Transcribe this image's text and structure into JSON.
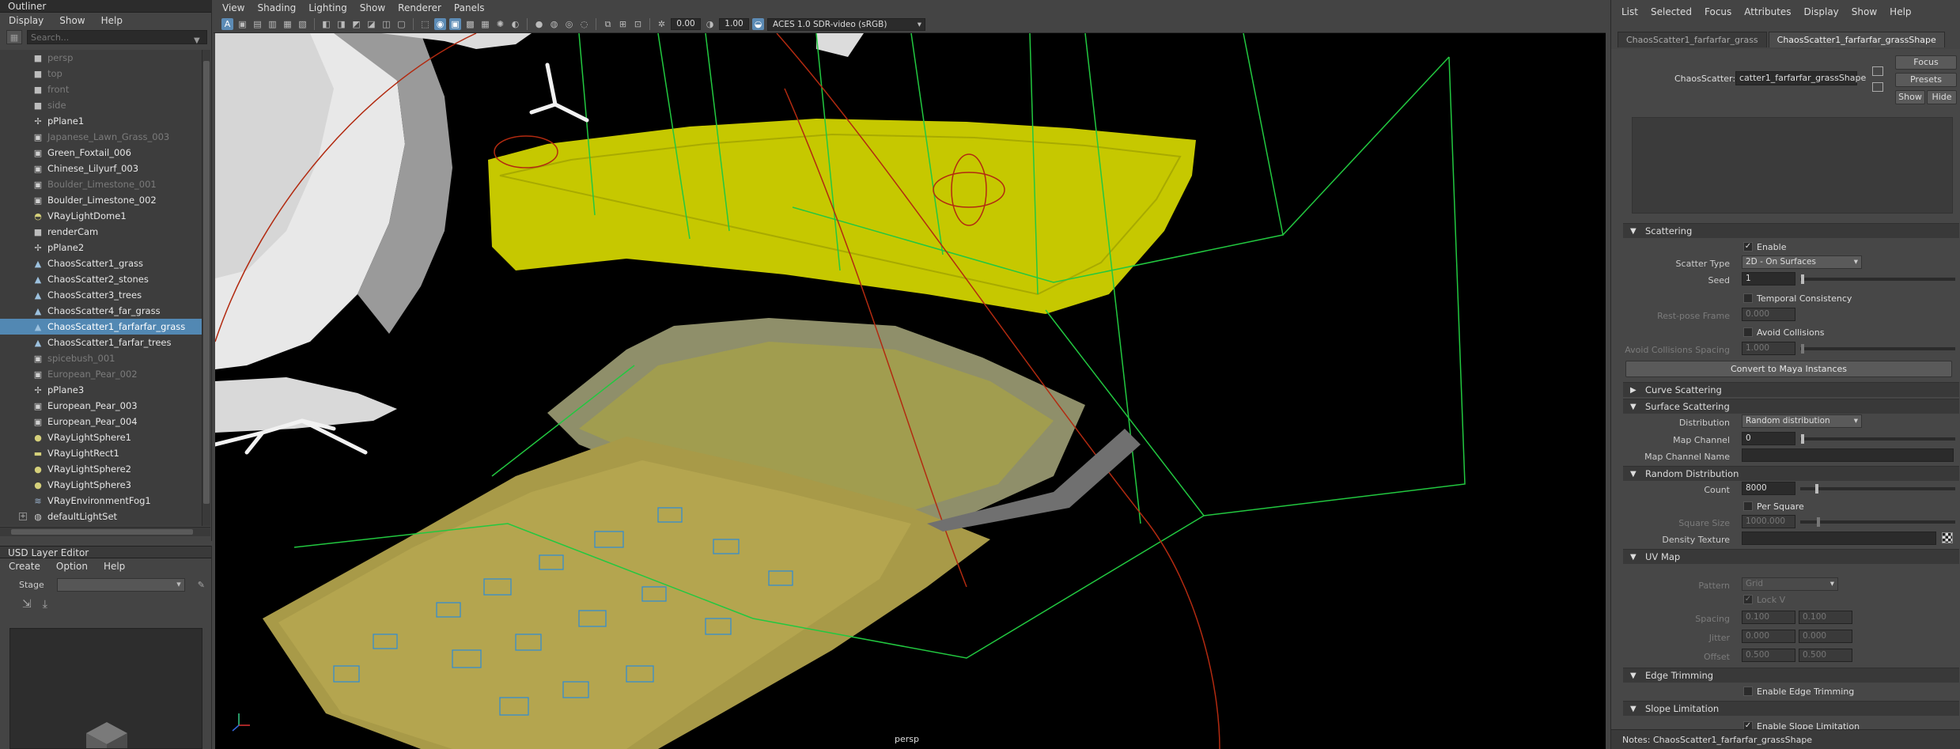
{
  "outliner": {
    "title": "Outliner",
    "menu": [
      "Display",
      "Show",
      "Help"
    ],
    "search_placeholder": "Search...",
    "items": [
      {
        "label": "persp",
        "icon": "camera-icon",
        "dim": true,
        "selected": false
      },
      {
        "label": "top",
        "icon": "camera-icon",
        "dim": true,
        "selected": false
      },
      {
        "label": "front",
        "icon": "camera-icon",
        "dim": true,
        "selected": false
      },
      {
        "label": "side",
        "icon": "camera-icon",
        "dim": true,
        "selected": false
      },
      {
        "label": "pPlane1",
        "icon": "transform-icon",
        "dim": false,
        "selected": false
      },
      {
        "label": "Japanese_Lawn_Grass_003",
        "icon": "mesh-icon",
        "dim": true,
        "selected": false
      },
      {
        "label": "Green_Foxtail_006",
        "icon": "mesh-icon",
        "dim": false,
        "selected": false
      },
      {
        "label": "Chinese_Lilyurf_003",
        "icon": "mesh-icon",
        "dim": false,
        "selected": false
      },
      {
        "label": "Boulder_Limestone_001",
        "icon": "mesh-icon",
        "dim": true,
        "selected": false
      },
      {
        "label": "Boulder_Limestone_002",
        "icon": "mesh-icon",
        "dim": false,
        "selected": false
      },
      {
        "label": "VRayLightDome1",
        "icon": "dome-light-icon",
        "dim": false,
        "selected": false
      },
      {
        "label": "renderCam",
        "icon": "camera-icon",
        "dim": false,
        "selected": false
      },
      {
        "label": "pPlane2",
        "icon": "transform-icon",
        "dim": false,
        "selected": false
      },
      {
        "label": "ChaosScatter1_grass",
        "icon": "scatter-icon",
        "dim": false,
        "selected": false
      },
      {
        "label": "ChaosScatter2_stones",
        "icon": "scatter-icon",
        "dim": false,
        "selected": false
      },
      {
        "label": "ChaosScatter3_trees",
        "icon": "scatter-icon",
        "dim": false,
        "selected": false
      },
      {
        "label": "ChaosScatter4_far_grass",
        "icon": "scatter-icon",
        "dim": false,
        "selected": false
      },
      {
        "label": "ChaosScatter1_farfarfar_grass",
        "icon": "scatter-icon",
        "dim": false,
        "selected": true
      },
      {
        "label": "ChaosScatter1_farfar_trees",
        "icon": "scatter-icon",
        "dim": false,
        "selected": false
      },
      {
        "label": "spicebush_001",
        "icon": "mesh-icon",
        "dim": true,
        "selected": false
      },
      {
        "label": "European_Pear_002",
        "icon": "mesh-icon",
        "dim": true,
        "selected": false
      },
      {
        "label": "pPlane3",
        "icon": "transform-icon",
        "dim": false,
        "selected": false
      },
      {
        "label": "European_Pear_003",
        "icon": "mesh-icon",
        "dim": false,
        "selected": false
      },
      {
        "label": "European_Pear_004",
        "icon": "mesh-icon",
        "dim": false,
        "selected": false
      },
      {
        "label": "VRayLightSphere1",
        "icon": "sphere-light-icon",
        "dim": false,
        "selected": false
      },
      {
        "label": "VRayLightRect1",
        "icon": "rect-light-icon",
        "dim": false,
        "selected": false
      },
      {
        "label": "VRayLightSphere2",
        "icon": "sphere-light-icon",
        "dim": false,
        "selected": false
      },
      {
        "label": "VRayLightSphere3",
        "icon": "sphere-light-icon",
        "dim": false,
        "selected": false
      },
      {
        "label": "VRayEnvironmentFog1",
        "icon": "fog-icon",
        "dim": false,
        "selected": false
      },
      {
        "label": "defaultLightSet",
        "icon": "set-icon",
        "dim": false,
        "selected": false,
        "expandable": true
      }
    ]
  },
  "usd": {
    "title": "USD Layer Editor",
    "menu": [
      "Create",
      "Option",
      "Help"
    ],
    "stage_label": "Stage"
  },
  "viewport": {
    "menu": [
      "View",
      "Shading",
      "Lighting",
      "Show",
      "Renderer",
      "Panels"
    ],
    "exposure": "0.00",
    "gamma": "1.00",
    "color_space": "ACES 1.0 SDR-video (sRGB)",
    "camera_label": "persp"
  },
  "attr": {
    "menu": [
      "List",
      "Selected",
      "Focus",
      "Attributes",
      "Display",
      "Show",
      "Help"
    ],
    "tabs": [
      "ChaosScatter1_farfarfar_grass",
      "ChaosScatter1_farfarfar_grassShape"
    ],
    "node_type_label": "ChaosScatter:",
    "node_name": "catter1_farfarfar_grassShape",
    "buttons": {
      "focus": "Focus",
      "presets": "Presets",
      "show": "Show",
      "hide": "Hide"
    },
    "scattering": {
      "title": "Scattering",
      "enable": "Enable",
      "scatter_type_label": "Scatter Type",
      "scatter_type": "2D - On Surfaces",
      "seed_label": "Seed",
      "seed": "1",
      "temporal": "Temporal Consistency",
      "rest_pose_label": "Rest-pose Frame",
      "rest_pose": "0.000",
      "avoid_collisions": "Avoid Collisions",
      "avoid_spacing_label": "Avoid Collisions Spacing",
      "avoid_spacing": "1.000",
      "convert_button": "Convert to Maya Instances"
    },
    "curve_scattering": {
      "title": "Curve Scattering"
    },
    "surface_scattering": {
      "title": "Surface Scattering",
      "distribution_label": "Distribution",
      "distribution": "Random distribution",
      "map_channel_label": "Map Channel",
      "map_channel": "0",
      "map_channel_name_label": "Map Channel Name"
    },
    "random_distribution": {
      "title": "Random Distribution",
      "count_label": "Count",
      "count": "8000",
      "per_square": "Per Square",
      "square_size_label": "Square Size",
      "square_size": "1000.000",
      "density_texture_label": "Density Texture"
    },
    "uv_map": {
      "title": "UV Map",
      "pattern_label": "Pattern",
      "pattern": "Grid",
      "lock_v": "Lock V",
      "spacing_label": "Spacing",
      "spacing_u": "0.100",
      "spacing_v": "0.100",
      "jitter_label": "Jitter",
      "jitter_u": "0.000",
      "jitter_v": "0.000",
      "offset_label": "Offset",
      "offset_u": "0.500",
      "offset_v": "0.500"
    },
    "edge_trimming": {
      "title": "Edge Trimming",
      "enable": "Enable Edge Trimming"
    },
    "slope_limitation": {
      "title": "Slope Limitation",
      "enable": "Enable Slope Limitation"
    },
    "notes": "Notes:  ChaosScatter1_farfarfar_grassShape"
  },
  "colors": {
    "selection": "#5288b3",
    "grass_yellow": "#c8c800",
    "wire_green": "#22c840",
    "wire_blue": "#2c8bd8"
  }
}
